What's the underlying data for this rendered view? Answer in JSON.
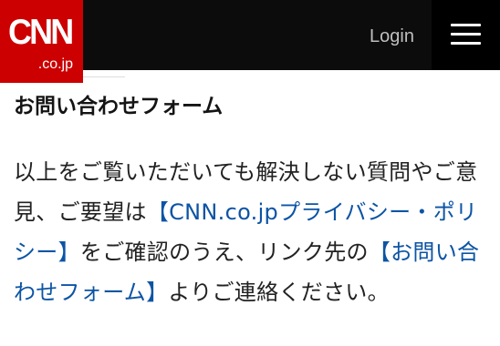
{
  "header": {
    "logo": {
      "mark": "CNN",
      "sub": ".co.jp"
    },
    "login_label": "Login",
    "menu_icon": "hamburger-menu-icon"
  },
  "main": {
    "title": "お問い合わせフォーム",
    "text_1": "以上をご覧いただいても解決しない質問やご意見、ご要望は",
    "link_privacy": "【CNN.co.jpプライバシー・ポリシー】",
    "text_2": "をご確認のうえ、リンク先の",
    "link_contact": "【お問い合わせフォーム】",
    "text_3": "よりご連絡ください。"
  },
  "colors": {
    "header_bg": "#0c0c0c",
    "brand_red": "#cc0000",
    "link": "#0c54a4",
    "text": "#222222"
  }
}
